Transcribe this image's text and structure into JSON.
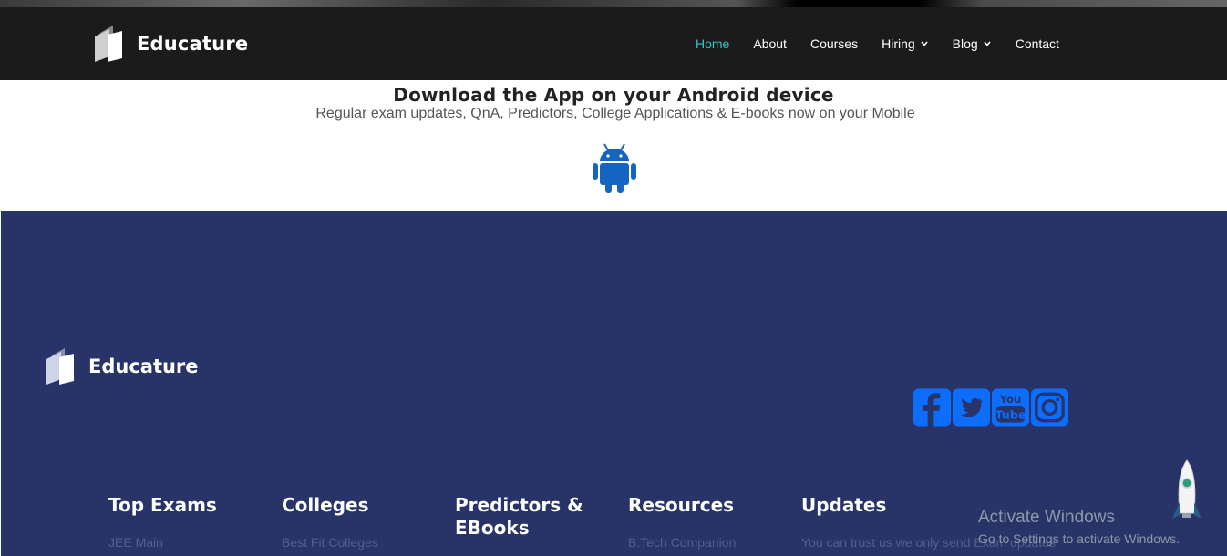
{
  "header": {
    "brand": "Educature",
    "nav": [
      {
        "label": "Home",
        "active": true
      },
      {
        "label": "About"
      },
      {
        "label": "Courses"
      },
      {
        "label": "Hiring",
        "dropdown": true
      },
      {
        "label": "Blog",
        "dropdown": true
      },
      {
        "label": "Contact"
      }
    ]
  },
  "promo": {
    "title": "Download the App on your Android device",
    "subtitle": "Regular exam updates, QnA, Predictors, College Applications & E-books now on your Mobile",
    "icon": "android-icon"
  },
  "footer": {
    "brand": "Educature",
    "social": [
      "facebook-icon",
      "twitter-icon",
      "youtube-icon",
      "instagram-icon"
    ],
    "columns": [
      {
        "title": "Top Exams",
        "first_link": "JEE Main"
      },
      {
        "title": "Colleges",
        "first_link": "Best Fit Colleges"
      },
      {
        "title": "Predictors & EBooks",
        "first_link": ""
      },
      {
        "title": "Resources",
        "first_link": "B.Tech Companion"
      },
      {
        "title": "Updates",
        "first_link": "You can trust us we only send Exam updates"
      }
    ]
  },
  "watermark": {
    "title": "Activate Windows",
    "subtitle": "Go to Settings to activate Windows."
  },
  "colors": {
    "navbar": "#1b1b1b",
    "active_nav": "#3cc4c4",
    "footer_bg": "#283468",
    "social_blue": "#0d6efd",
    "android_blue": "#1565c0"
  }
}
